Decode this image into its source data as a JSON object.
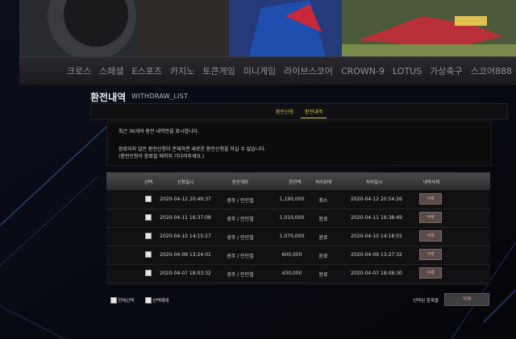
{
  "nav": {
    "items": [
      "크로스",
      "스페셜",
      "E스포츠",
      "카지노",
      "토큰게임",
      "미니게임",
      "라이브스코어",
      "CROWN-9",
      "LOTUS",
      "가상축구",
      "스코어888"
    ]
  },
  "page": {
    "title": "환전내역",
    "subtitle": "WITHDRAW_LIST"
  },
  "tabs": [
    {
      "label": "환전신청",
      "active": false
    },
    {
      "label": "환전내역",
      "active": true
    }
  ],
  "notice": {
    "line1": "최근 30개의 환전 내역만을 표시합니다.",
    "line2": "완료되지 않은 환전신청이 존재하면 새로운 환전신청을 하실 수 없습니다.",
    "line3": "(환전신청이 완료될 때까지 기다려주세요.)"
  },
  "table": {
    "headers": [
      "선택",
      "신청일시",
      "환전계좌",
      "환전액",
      "처리상태",
      "처리일시",
      "내역삭제"
    ],
    "rows": [
      {
        "requested": "2020-04-12 20:46:37",
        "account": "광주 / 민민철",
        "amount": "1,190,000",
        "status": "취소",
        "processed": "2020-04-12 20:54:26",
        "delete": "삭제"
      },
      {
        "requested": "2020-04-11 16:37:08",
        "account": "광주 / 민민철",
        "amount": "1,010,000",
        "status": "완료",
        "processed": "2020-04-11 16:38:49",
        "delete": "삭제"
      },
      {
        "requested": "2020-04-10 14:15:27",
        "account": "광주 / 민민철",
        "amount": "1,070,000",
        "status": "완료",
        "processed": "2020-04-10 14:18:55",
        "delete": "삭제"
      },
      {
        "requested": "2020-04-09 13:24:01",
        "account": "광주 / 민민철",
        "amount": "600,000",
        "status": "완료",
        "processed": "2020-04-09 13:27:32",
        "delete": "삭제"
      },
      {
        "requested": "2020-04-07 18:03:32",
        "account": "광주 / 민민철",
        "amount": "430,000",
        "status": "완료",
        "processed": "2020-04-07 18:08:30",
        "delete": "삭제"
      }
    ]
  },
  "footer": {
    "select_all": "전체선택",
    "deselect_all": "선택해제",
    "selected_label": "선택된 항목을",
    "delete_button": "삭제"
  },
  "colors": {
    "accent": "#e3c25a",
    "delete_text": "#e6a8a0"
  }
}
